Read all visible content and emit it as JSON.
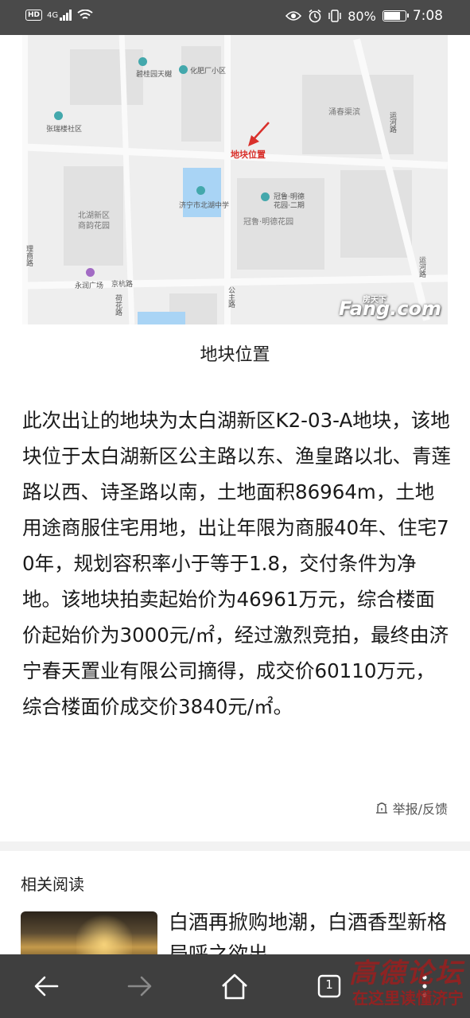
{
  "status_bar": {
    "hd": "HD",
    "signal": "4G",
    "battery_percent_text": "80%",
    "battery_level": 0.8,
    "time": "7:08"
  },
  "map": {
    "labels": {
      "biguiyuan": "碧桂园天樾",
      "huafei": "化肥厂小区",
      "zhangzhuang": "张瑞楼社区",
      "yongchun": "涌春渠滨",
      "yunhe_top": "运河路",
      "beihu": "北湖新区",
      "shangyun": "商韵花园",
      "beihu_school": "济宁市北湖中学",
      "guanlu": "冠鲁·明德",
      "guanlu2": "花园·二期",
      "guanlu_main": "冠鲁·明德花园",
      "yunhe_right": "运河路",
      "liyuan": "理商路",
      "yongrun": "永润广场",
      "jinghang": "京杭路",
      "gongzhu": "公主路",
      "hehua": "荷花路"
    },
    "target_label": "地块位置",
    "watermark_top": "房天下",
    "watermark": "Fang.com"
  },
  "caption": "地块位置",
  "article": {
    "body": "此次出让的地块为太白湖新区K2-03-A地块，该地块位于太白湖新区公主路以东、渔皇路以北、青莲路以西、诗圣路以南，土地面积86964m，土地用途商服住宅用地，出让年限为商服40年、住宅70年，规划容积率小于等于1.8，交付条件为净地。该地块拍卖起始价为46961万元，综合楼面价起始价为3000元/㎡，经过激烈竞拍，最终由济宁春天置业有限公司摘得，成交价60110万元，综合楼面价成交价3840元/㎡。"
  },
  "report_label": "举报/反馈",
  "related": {
    "title": "相关阅读",
    "items": [
      {
        "title": "白酒再掀购地潮，白酒香型新格局呼之欲出"
      }
    ]
  },
  "nav": {
    "tab_count": "1"
  },
  "forum_watermark": {
    "line1": "高德论坛",
    "line2": "在这里读懂济宁"
  }
}
